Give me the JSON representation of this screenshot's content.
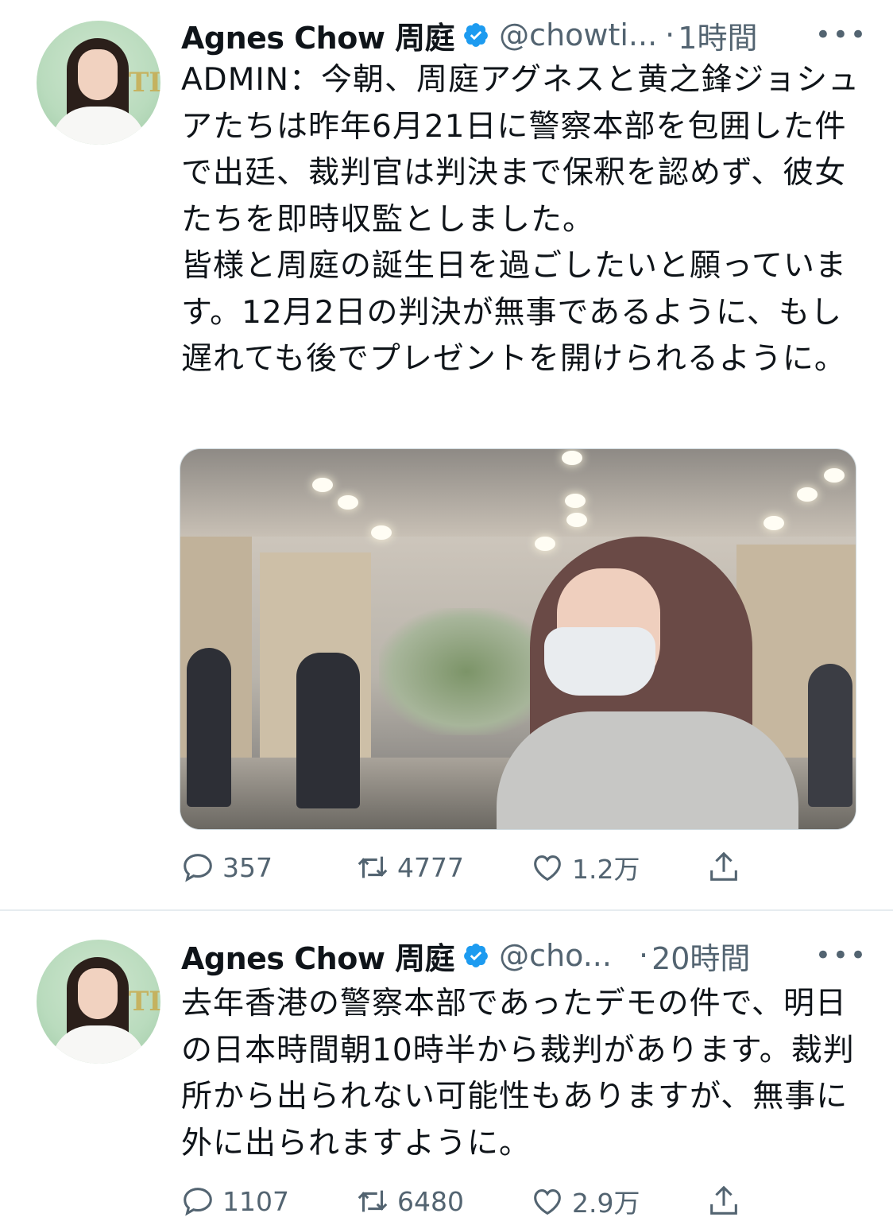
{
  "tweets": [
    {
      "author_name": "Agnes Chow 周庭",
      "handle": "@chowti...",
      "separator": "·",
      "time": "1時間",
      "more": "•••",
      "text": "ADMIN：今朝、周庭アグネスと黄之鋒ジョシュアたちは昨年6月21日に警察本部を包囲した件で出廷、裁判官は判決まで保釈を認めず、彼女たちを即時収監としました。\n皆様と周庭の誕生日を過ごしたいと願っています。12月2日の判決が無事であるように、もし遅れても後でプレゼントを開けられるように。",
      "has_photo": true,
      "replies": "357",
      "retweets": "4777",
      "likes": "1.2万"
    },
    {
      "author_name": "Agnes Chow 周庭",
      "handle": "@cho...",
      "separator": "·",
      "time": "20時間",
      "more": "•••",
      "text": "去年香港の警察本部であったデモの件で、明日の日本時間朝10時半から裁判があります。裁判所から出られない可能性もありますが、無事に外に出られますように。",
      "has_photo": false,
      "replies": "1107",
      "retweets": "6480",
      "likes": "2.9万"
    }
  ],
  "colors": {
    "text": "#0f1419",
    "secondary": "#536471",
    "verified": "#1d9bf0",
    "divider": "#e6ecf0"
  },
  "icons": [
    "verified-badge-icon",
    "reply-icon",
    "retweet-icon",
    "like-icon",
    "share-icon",
    "more-icon"
  ]
}
